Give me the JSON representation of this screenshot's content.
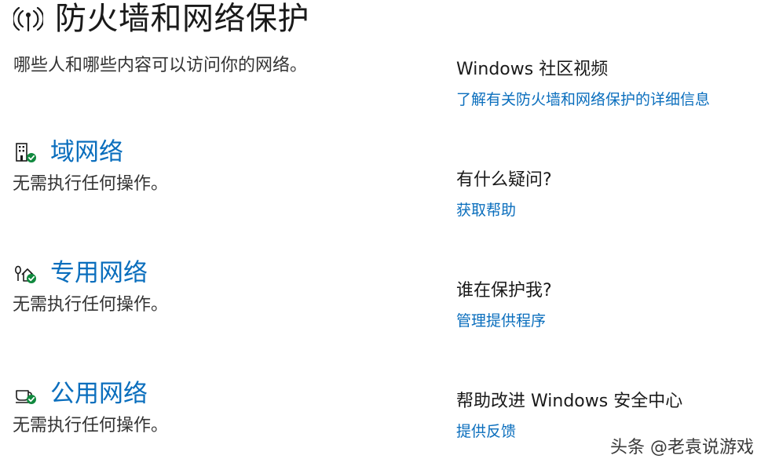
{
  "header": {
    "icon": "antenna-icon",
    "title": "防火墙和网络保护",
    "subtitle": "哪些人和哪些内容可以访问你的网络。"
  },
  "networks": [
    {
      "icon": "domain-network-icon",
      "label": "域网络",
      "status": "无需执行任何操作。",
      "status_color": "#10893e"
    },
    {
      "icon": "private-network-icon",
      "label": "专用网络",
      "status": "无需执行任何操作。",
      "status_color": "#10893e"
    },
    {
      "icon": "public-network-icon",
      "label": "公用网络",
      "status": "无需执行任何操作。",
      "status_color": "#10893e"
    }
  ],
  "sidebar": [
    {
      "title": "Windows 社区视频",
      "link": "了解有关防火墙和网络保护的详细信息"
    },
    {
      "title": "有什么疑问?",
      "link": "获取帮助"
    },
    {
      "title": "谁在保护我?",
      "link": "管理提供程序"
    },
    {
      "title": "帮助改进 Windows 安全中心",
      "link": "提供反馈"
    }
  ],
  "watermark": "头条 @老袁说游戏",
  "colors": {
    "link": "#0a6ebd",
    "check": "#10893e",
    "text": "#1f1f1f"
  }
}
